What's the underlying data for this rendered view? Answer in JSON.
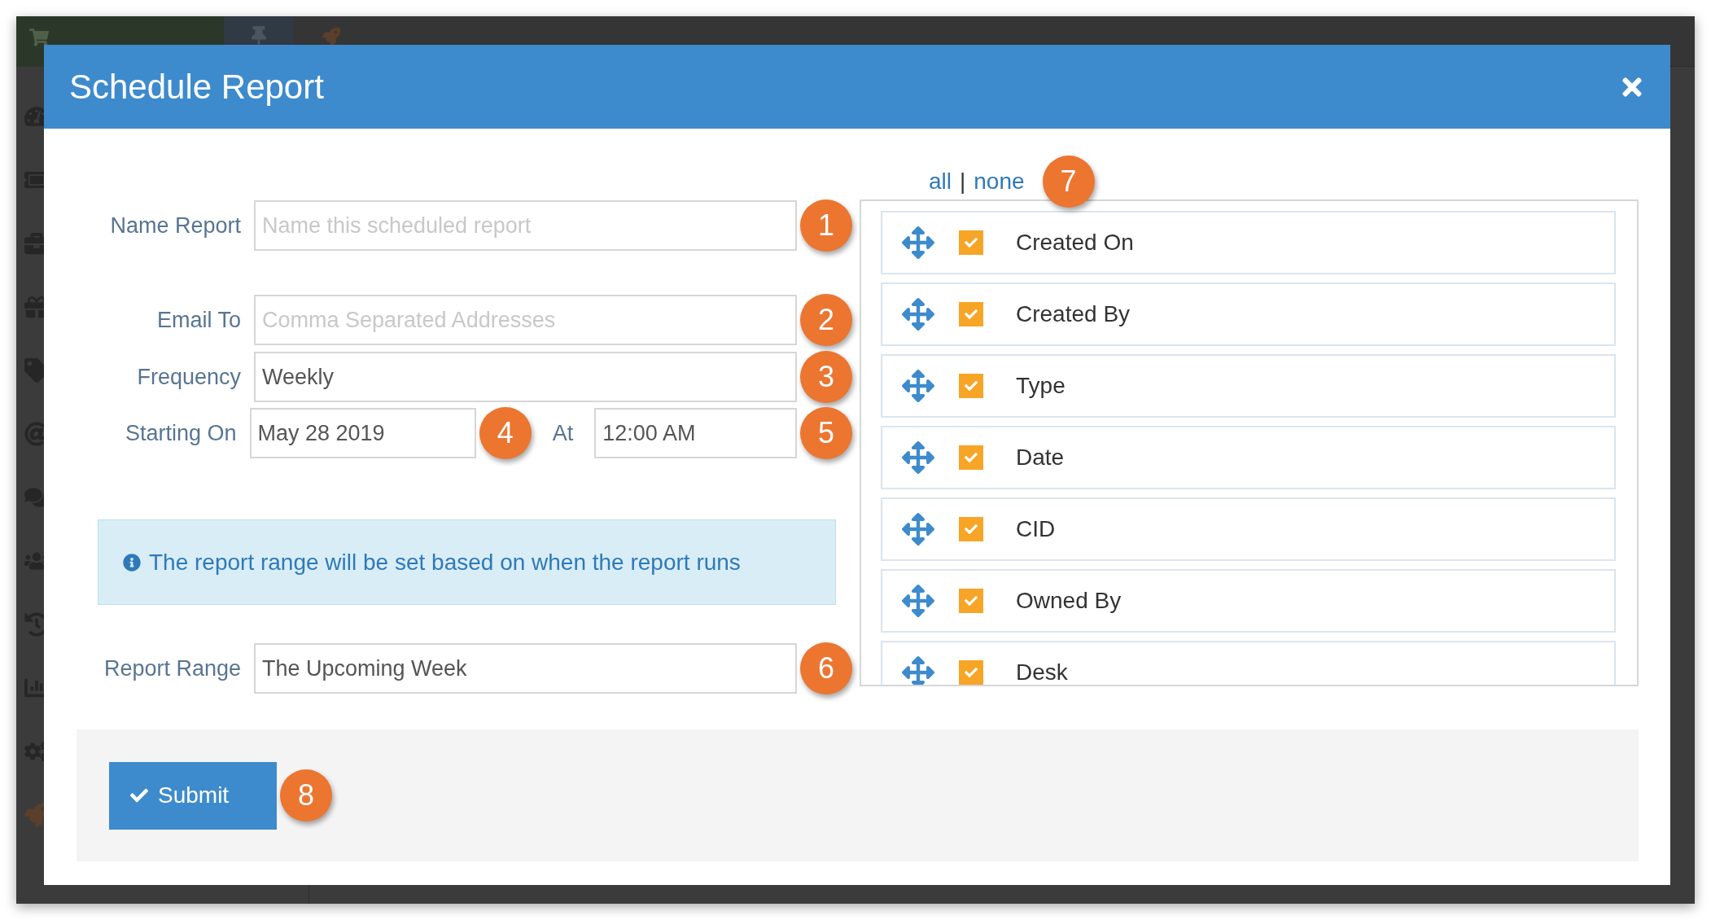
{
  "dialog": {
    "title": "Schedule Report",
    "name_report": {
      "label": "Name Report",
      "placeholder": "Name this scheduled report",
      "callout": "1"
    },
    "email_to": {
      "label": "Email To",
      "placeholder": "Comma Separated Addresses",
      "callout": "2"
    },
    "frequency": {
      "label": "Frequency",
      "value": "Weekly",
      "callout": "3"
    },
    "starting_on": {
      "label": "Starting On",
      "date": "May 28 2019",
      "date_callout": "4",
      "at_label": "At",
      "time": "12:00 AM",
      "time_callout": "5"
    },
    "info": "The report range will be set based on when the report runs",
    "report_range": {
      "label": "Report Range",
      "value": "The Upcoming Week",
      "callout": "6"
    },
    "columns": {
      "all": "all",
      "separator": "|",
      "none": "none",
      "callout": "7",
      "items": [
        {
          "label": "Created On",
          "checked": true
        },
        {
          "label": "Created By",
          "checked": true
        },
        {
          "label": "Type",
          "checked": true
        },
        {
          "label": "Date",
          "checked": true
        },
        {
          "label": "CID",
          "checked": true
        },
        {
          "label": "Owned By",
          "checked": true
        },
        {
          "label": "Desk",
          "checked": true
        }
      ]
    },
    "submit": {
      "label": "Submit",
      "callout": "8"
    }
  }
}
